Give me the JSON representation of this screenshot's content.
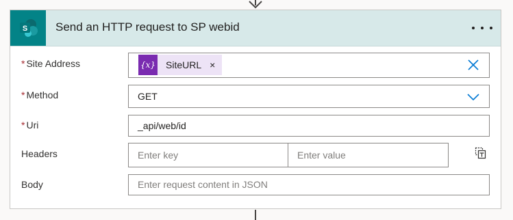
{
  "action": {
    "title": "Send an HTTP request to SP webid",
    "logo_letter": "S",
    "accent_color": "#038387"
  },
  "fields": {
    "site_address": {
      "required_mark": "*",
      "label": "Site Address",
      "token": {
        "icon_text": "{x}",
        "label": "SiteURL",
        "remove": "×"
      }
    },
    "method": {
      "required_mark": "*",
      "label": "Method",
      "value": "GET"
    },
    "uri": {
      "required_mark": "*",
      "label": "Uri",
      "value": "_api/web/id"
    },
    "headers": {
      "label": "Headers",
      "key_placeholder": "Enter key",
      "value_placeholder": "Enter value"
    },
    "body": {
      "label": "Body",
      "placeholder": "Enter request content in JSON"
    }
  }
}
